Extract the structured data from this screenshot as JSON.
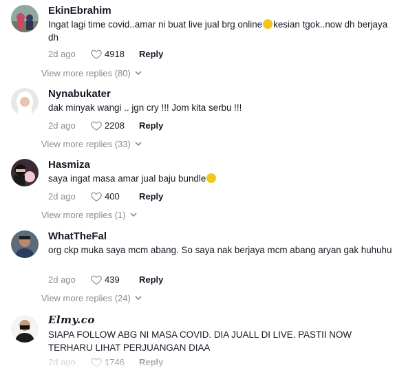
{
  "comments": [
    {
      "username": "EkinEbrahim",
      "text_before_emoji": "Ingat lagi time covid..amar ni buat live jual brg online",
      "emoji": "loudly-crying-face",
      "text_after_emoji": "kesian tgok..now dh berjaya dh",
      "date": "2d ago",
      "likes": "4918",
      "reply_label": "Reply",
      "view_more": "View more replies (80)"
    },
    {
      "username": "Nynabukater",
      "text": "dak minyak wangi .. jgn cry !!! Jom kita serbu !!!",
      "date": "2d ago",
      "likes": "2208",
      "reply_label": "Reply",
      "view_more": "View more replies (33)"
    },
    {
      "username": "Hasmiza",
      "text_before_emoji": "saya ingat masa amar jual baju bundle",
      "emoji": "pleading-face",
      "date": "2d ago",
      "likes": "400",
      "reply_label": "Reply",
      "view_more": "View more replies (1)"
    },
    {
      "username": "WhatTheFal",
      "text": "org ckp muka saya mcm abang. So saya nak berjaya mcm abang aryan gak huhuhu",
      "date": "2d ago",
      "likes": "439",
      "reply_label": "Reply",
      "view_more": "View more replies (24)"
    },
    {
      "username": "Elmy.co",
      "text": "SIAPA FOLLOW ABG NI MASA COVID. DIA JUALL DI LIVE. PASTII NOW TERHARU LIHAT PERJUANGAN DIAA",
      "date": "2d ago",
      "likes": "1746",
      "reply_label": "Reply"
    }
  ],
  "colors": {
    "primary_text": "#161823",
    "secondary_text": "#8a8b91",
    "emoji_yellow": "#f5c518"
  },
  "icons": {
    "like": "heart-outline-icon",
    "expand": "chevron-down-icon"
  }
}
